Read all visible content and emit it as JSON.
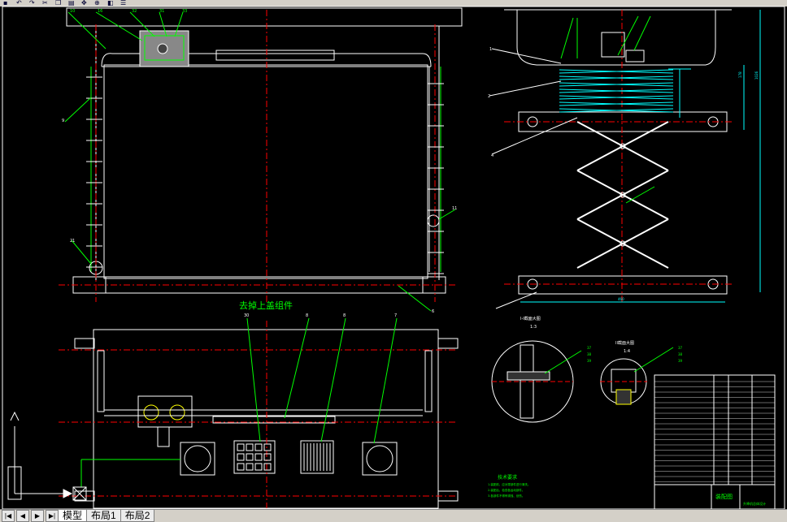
{
  "toolbar": {
    "icons": [
      "open-icon",
      "undo-icon",
      "redo-icon",
      "cut-icon",
      "copy-icon",
      "paste-icon",
      "pan-icon",
      "zoom-icon",
      "layer-icon",
      "properties-icon"
    ]
  },
  "drawing": {
    "annotation_main": "去掉上盖组件",
    "detail_b_title": "I-I截面大图",
    "detail_b_scale": "1:3",
    "detail_c_title": "II截面大图",
    "detail_c_scale": "1:4",
    "tech_req_title": "技术要求",
    "tech_req_lines": [
      "1.装配前，应对零部件进行清洗。",
      "2.装配后，检查各运动部件。",
      "3.各部件不得有锈蚀、划伤。"
    ],
    "title_block_name": "装配图",
    "title_block_sub": "升降机总体设计",
    "balloons_front": [
      "10",
      "16",
      "32",
      "31",
      "33",
      "9",
      "21",
      "6",
      "11"
    ],
    "balloons_bottom": [
      "30",
      "8",
      "8",
      "7"
    ],
    "balloons_side": [
      "1",
      "2",
      "4"
    ],
    "balloons_detail": [
      "37",
      "38",
      "39",
      "37",
      "38",
      "39"
    ],
    "dim_side_height": "1026",
    "dim_side_top": "178",
    "dim_side_width": "460"
  },
  "tabs": {
    "model": "模型",
    "layout1": "布局1",
    "layout2": "布局2"
  },
  "colors": {
    "background": "#000000",
    "outline": "#ffffff",
    "centerline": "#ff0000",
    "leader": "#00ff00",
    "dimension": "#00ffff",
    "hatch": "#ffffff"
  }
}
